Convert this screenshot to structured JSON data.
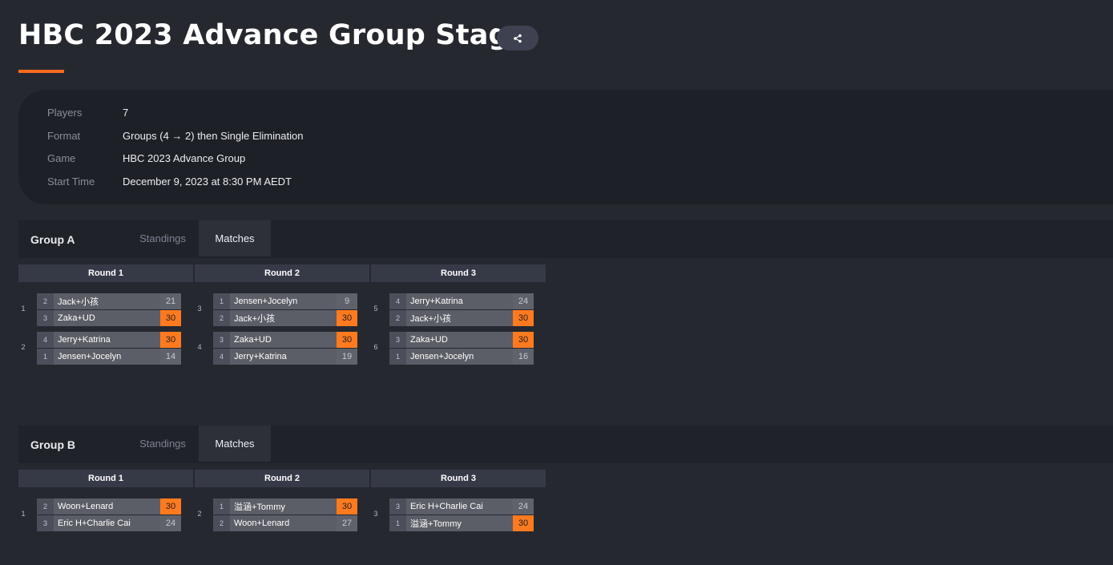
{
  "page": {
    "title": "HBC 2023 Advance Group Stage",
    "share_icon": "share-icon"
  },
  "info": [
    {
      "label": "Players",
      "value": "7"
    },
    {
      "label": "Format",
      "value": "Groups (4 → 2) then Single Elimination"
    },
    {
      "label": "Game",
      "value": "HBC 2023 Advance Group"
    },
    {
      "label": "Start Time",
      "value": "December 9, 2023 at 8:30 PM AEDT"
    }
  ],
  "colors": {
    "accent": "#ff6a1e",
    "win_score": "#ff7a1f",
    "background": "#262830"
  },
  "groups": [
    {
      "name": "Group A",
      "tabs": {
        "standings": "Standings",
        "matches": "Matches"
      },
      "rounds": [
        {
          "label": "Round 1",
          "matches": [
            {
              "num": "1",
              "p1": {
                "seed": "2",
                "name": "Jack+小孩",
                "score": "21",
                "win": false
              },
              "p2": {
                "seed": "3",
                "name": "Zaka+UD",
                "score": "30",
                "win": true
              }
            },
            {
              "num": "2",
              "p1": {
                "seed": "4",
                "name": "Jerry+Katrina",
                "score": "30",
                "win": true
              },
              "p2": {
                "seed": "1",
                "name": "Jensen+Jocelyn",
                "score": "14",
                "win": false
              }
            }
          ]
        },
        {
          "label": "Round 2",
          "matches": [
            {
              "num": "3",
              "p1": {
                "seed": "1",
                "name": "Jensen+Jocelyn",
                "score": "9",
                "win": false
              },
              "p2": {
                "seed": "2",
                "name": "Jack+小孩",
                "score": "30",
                "win": true
              }
            },
            {
              "num": "4",
              "p1": {
                "seed": "3",
                "name": "Zaka+UD",
                "score": "30",
                "win": true
              },
              "p2": {
                "seed": "4",
                "name": "Jerry+Katrina",
                "score": "19",
                "win": false
              }
            }
          ]
        },
        {
          "label": "Round 3",
          "matches": [
            {
              "num": "5",
              "p1": {
                "seed": "4",
                "name": "Jerry+Katrina",
                "score": "24",
                "win": false
              },
              "p2": {
                "seed": "2",
                "name": "Jack+小孩",
                "score": "30",
                "win": true
              }
            },
            {
              "num": "6",
              "p1": {
                "seed": "3",
                "name": "Zaka+UD",
                "score": "30",
                "win": true
              },
              "p2": {
                "seed": "1",
                "name": "Jensen+Jocelyn",
                "score": "16",
                "win": false
              }
            }
          ]
        }
      ]
    },
    {
      "name": "Group B",
      "tabs": {
        "standings": "Standings",
        "matches": "Matches"
      },
      "rounds": [
        {
          "label": "Round 1",
          "matches": [
            {
              "num": "1",
              "p1": {
                "seed": "2",
                "name": "Woon+Lenard",
                "score": "30",
                "win": true
              },
              "p2": {
                "seed": "3",
                "name": "Eric H+Charlie Cai",
                "score": "24",
                "win": false
              }
            }
          ]
        },
        {
          "label": "Round 2",
          "matches": [
            {
              "num": "2",
              "p1": {
                "seed": "1",
                "name": "溢涵+Tommy",
                "score": "30",
                "win": true
              },
              "p2": {
                "seed": "2",
                "name": "Woon+Lenard",
                "score": "27",
                "win": false
              }
            }
          ]
        },
        {
          "label": "Round 3",
          "matches": [
            {
              "num": "3",
              "p1": {
                "seed": "3",
                "name": "Eric H+Charlie Cai",
                "score": "24",
                "win": false
              },
              "p2": {
                "seed": "1",
                "name": "溢涵+Tommy",
                "score": "30",
                "win": true
              }
            }
          ]
        }
      ]
    }
  ]
}
